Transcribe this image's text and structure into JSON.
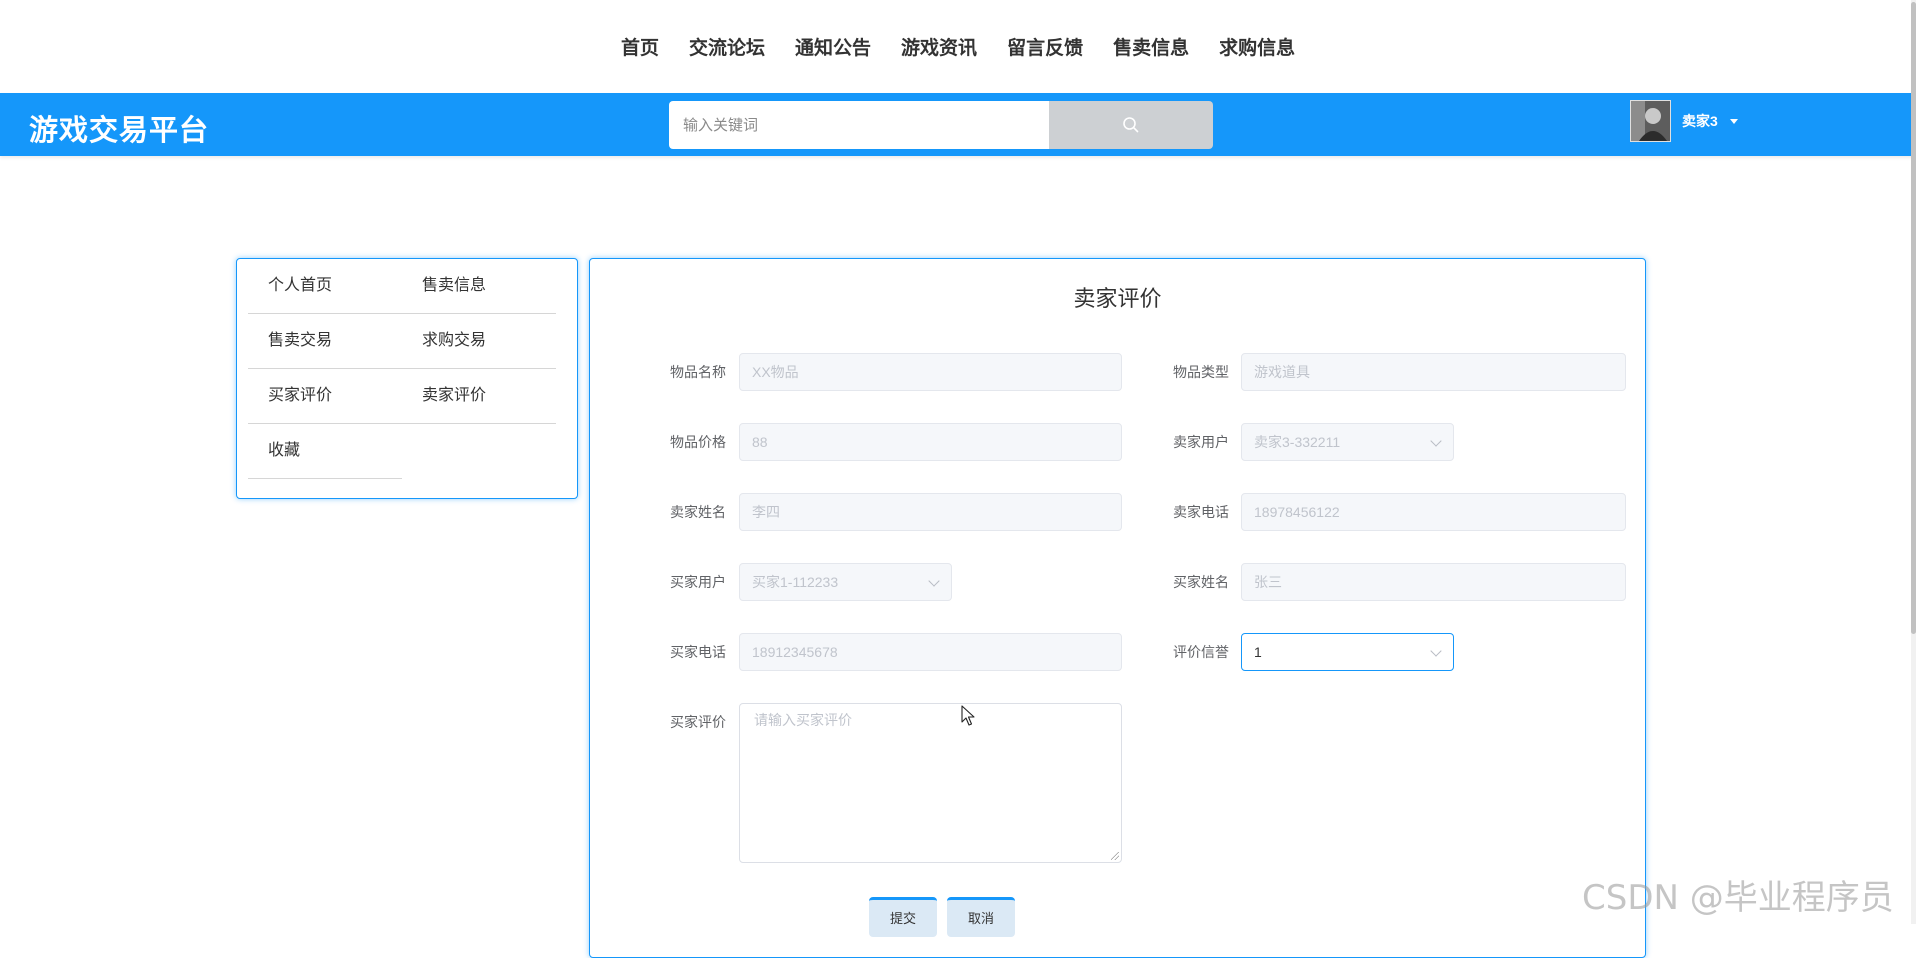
{
  "top_nav": {
    "items": [
      "首页",
      "交流论坛",
      "通知公告",
      "游戏资讯",
      "留言反馈",
      "售卖信息",
      "求购信息"
    ]
  },
  "header": {
    "logo": "游戏交易平台",
    "search_placeholder": "输入关键词",
    "username": "卖家3",
    "accent_color": "#1597fa"
  },
  "side_menu": {
    "items": [
      "个人首页",
      "售卖信息",
      "售卖交易",
      "求购交易",
      "买家评价",
      "卖家评价",
      "收藏"
    ]
  },
  "form": {
    "title": "卖家评价",
    "item_name_label": "物品名称",
    "item_name_value": "XX物品",
    "item_type_label": "物品类型",
    "item_type_value": "游戏道具",
    "item_price_label": "物品价格",
    "item_price_value": "88",
    "seller_user_label": "卖家用户",
    "seller_user_value": "卖家3-332211",
    "seller_name_label": "卖家姓名",
    "seller_name_value": "李四",
    "seller_phone_label": "卖家电话",
    "seller_phone_value": "18978456122",
    "buyer_user_label": "买家用户",
    "buyer_user_value": "买家1-112233",
    "buyer_name_label": "买家姓名",
    "buyer_name_value": "张三",
    "buyer_phone_label": "买家电话",
    "buyer_phone_value": "18912345678",
    "rating_label": "评价信誉",
    "rating_value": "1",
    "buyer_review_label": "买家评价",
    "buyer_review_placeholder": "请输入买家评价",
    "submit_label": "提交",
    "cancel_label": "取消"
  },
  "watermark": "CSDN @毕业程序员"
}
